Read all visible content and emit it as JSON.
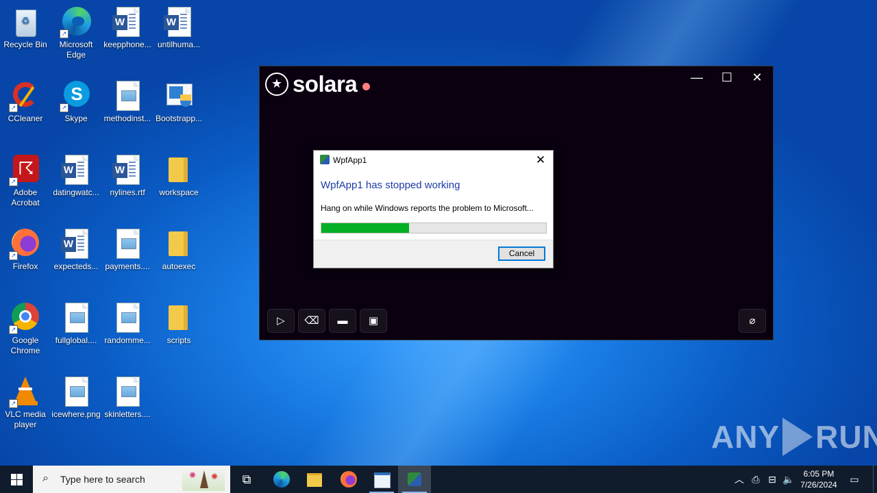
{
  "desktop": {
    "icons": [
      {
        "label": "Recycle Bin",
        "type": "recycle-bin"
      },
      {
        "label": "Microsoft Edge",
        "type": "edge"
      },
      {
        "label": "keepphone...",
        "type": "word-doc"
      },
      {
        "label": "untilhuma...",
        "type": "word-doc"
      },
      {
        "label": "CCleaner",
        "type": "ccleaner"
      },
      {
        "label": "Skype",
        "type": "skype"
      },
      {
        "label": "methodinst...",
        "type": "image-file"
      },
      {
        "label": "Bootstrapp...",
        "type": "installer"
      },
      {
        "label": "Adobe Acrobat",
        "type": "acrobat"
      },
      {
        "label": "datingwatc...",
        "type": "word-doc"
      },
      {
        "label": "nylines.rtf",
        "type": "word-doc"
      },
      {
        "label": "workspace",
        "type": "folder"
      },
      {
        "label": "Firefox",
        "type": "firefox"
      },
      {
        "label": "expecteds...",
        "type": "word-doc"
      },
      {
        "label": "payments....",
        "type": "image-file"
      },
      {
        "label": "autoexec",
        "type": "folder"
      },
      {
        "label": "Google Chrome",
        "type": "chrome"
      },
      {
        "label": "fullglobal....",
        "type": "image-file"
      },
      {
        "label": "randomme...",
        "type": "image-file"
      },
      {
        "label": "scripts",
        "type": "folder"
      },
      {
        "label": "VLC media player",
        "type": "vlc"
      },
      {
        "label": "icewhere.png",
        "type": "image-file"
      },
      {
        "label": "skinletters....",
        "type": "image-file"
      }
    ]
  },
  "solara": {
    "app_name": "solara",
    "status_dot_color": "#ff7f7f",
    "controls": {
      "minimize": "—",
      "maximize": "☐",
      "close": "✕"
    },
    "toolbar": {
      "run_icon": "play-icon",
      "clear_icon": "eraser-icon",
      "open_icon": "folder-icon",
      "save_icon": "save-icon",
      "attach_icon": "paperclip-icon"
    }
  },
  "dialog": {
    "title": "WpfApp1",
    "heading": "WpfApp1 has stopped working",
    "message": "Hang on while Windows reports the problem to Microsoft...",
    "progress": 0.39,
    "cancel_label": "Cancel",
    "heading_color": "#1c3aa6",
    "progress_color": "#06b025"
  },
  "watermark": {
    "left": "ANY",
    "right": "RUN"
  },
  "taskbar": {
    "search_placeholder": "Type here to search",
    "clock_time": "6:05 PM",
    "clock_date": "7/26/2024"
  }
}
